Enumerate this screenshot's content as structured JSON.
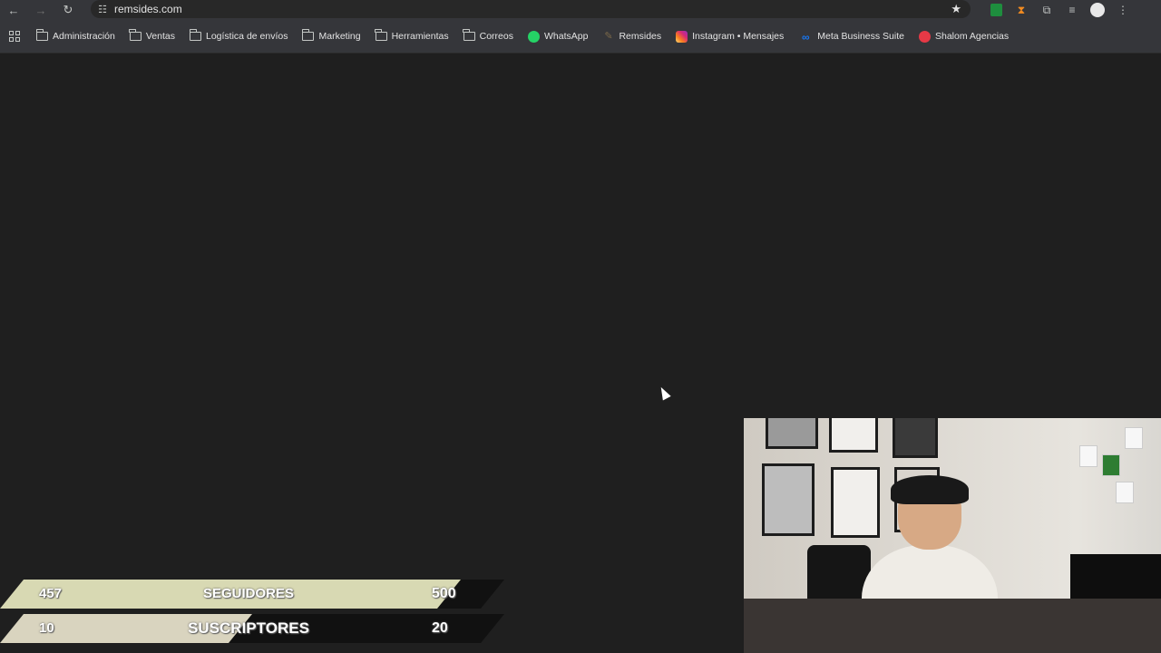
{
  "browser": {
    "url": "remsides.com",
    "bookmarks": [
      {
        "label": "Administración",
        "icon": "folder-icon"
      },
      {
        "label": "Ventas",
        "icon": "folder-icon"
      },
      {
        "label": "Logística de envíos",
        "icon": "folder-icon"
      },
      {
        "label": "Marketing",
        "icon": "folder-icon"
      },
      {
        "label": "Herramientas",
        "icon": "folder-icon"
      },
      {
        "label": "Correos",
        "icon": "folder-icon"
      },
      {
        "label": "WhatsApp",
        "icon": "whatsapp-icon"
      },
      {
        "label": "Remsides",
        "icon": "remsides-icon"
      },
      {
        "label": "Instagram • Mensajes",
        "icon": "instagram-icon"
      },
      {
        "label": "Meta Business Suite",
        "icon": "meta-icon"
      },
      {
        "label": "Shalom Agencias",
        "icon": "shalom-icon"
      }
    ]
  },
  "overlay": {
    "followers": {
      "current": "457",
      "label": "SEGUIDORES",
      "goal": "500",
      "progress": 0.914
    },
    "subscribers": {
      "current": "10",
      "label": "SUSCRIPTORES",
      "goal": "20",
      "progress": 0.5
    }
  },
  "colors": {
    "page_bg": "#1f1f1f",
    "toolbar_bg": "#35363a",
    "followers_bar": "#d8d9b3",
    "subscribers_bar": "#d9d4bf"
  }
}
